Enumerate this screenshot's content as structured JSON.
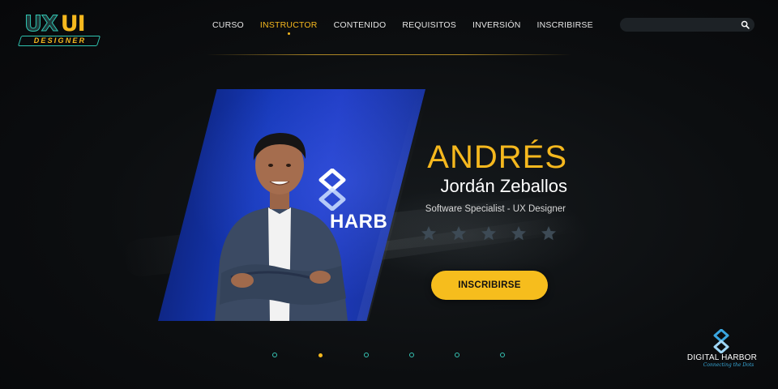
{
  "logo": {
    "top_left": "UX",
    "top_right": "UI",
    "sub": "DESIGNER"
  },
  "nav": {
    "items": [
      {
        "label": "CURSO",
        "active": false
      },
      {
        "label": "INSTRUCTOR",
        "active": true
      },
      {
        "label": "CONTENIDO",
        "active": false
      },
      {
        "label": "REQUISITOS",
        "active": false
      },
      {
        "label": "INVERSIÓN",
        "active": false
      },
      {
        "label": "INSCRIBIRSE",
        "active": false
      }
    ]
  },
  "search": {
    "value": "",
    "placeholder": "",
    "icon": "search-icon"
  },
  "instructor": {
    "first_name": "ANDRÉS",
    "last_name": "Jordán Zeballos",
    "role": "Software Specialist - UX Designer",
    "rating_stars": 5,
    "photo_backdrop_text": "HARB"
  },
  "cta": {
    "label": "INSCRIBIRSE"
  },
  "pagination": {
    "count": 6,
    "active_index": 1
  },
  "brand": {
    "name": "DIGITAL HARBOR",
    "tagline": "Connecting the Dots"
  },
  "colors": {
    "accent": "#f5b81e",
    "teal": "#2fc3b0",
    "background": "#0c0e10",
    "button": "#f6bd1d",
    "photo_blue": "#1538b8",
    "star": "#3d4a55"
  }
}
